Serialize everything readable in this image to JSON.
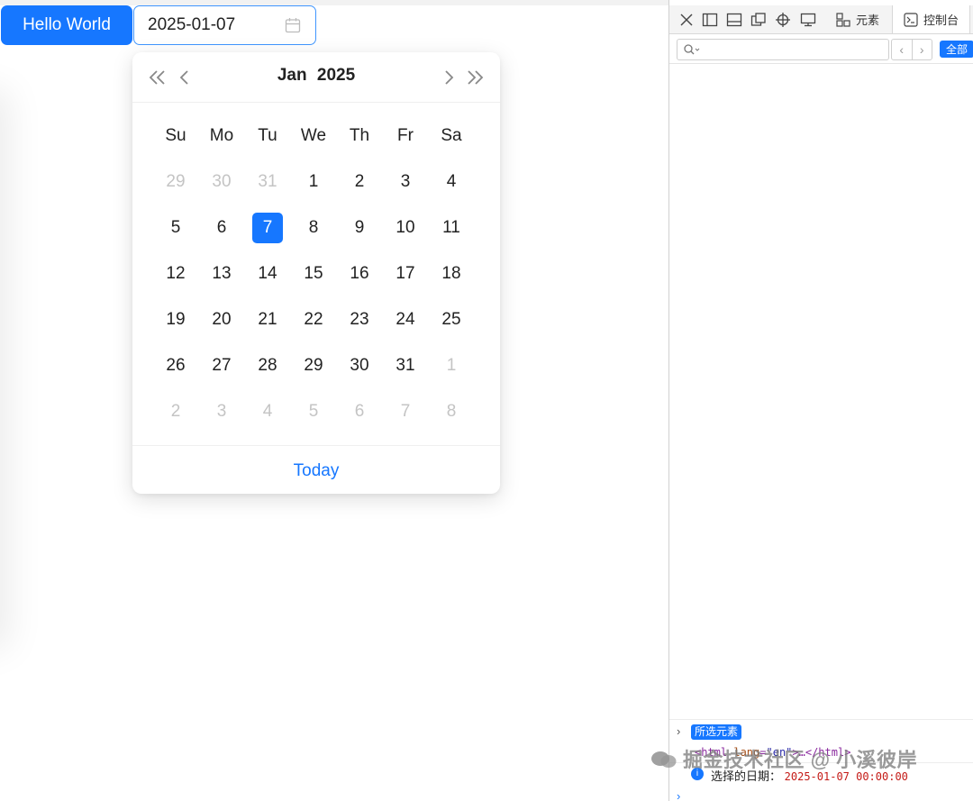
{
  "page": {
    "hello_button": "Hello World",
    "date_value": "2025-01-07",
    "calendar_icon": "calendar-icon"
  },
  "picker": {
    "month": "Jan",
    "year": "2025",
    "nav_icons": [
      "double-chevron-left-icon",
      "chevron-left-icon",
      "chevron-right-icon",
      "double-chevron-right-icon"
    ],
    "weekdays": [
      "Su",
      "Mo",
      "Tu",
      "We",
      "Th",
      "Fr",
      "Sa"
    ],
    "weeks": [
      [
        {
          "d": "29",
          "muted": true
        },
        {
          "d": "30",
          "muted": true
        },
        {
          "d": "31",
          "muted": true
        },
        {
          "d": "1"
        },
        {
          "d": "2"
        },
        {
          "d": "3"
        },
        {
          "d": "4"
        }
      ],
      [
        {
          "d": "5"
        },
        {
          "d": "6"
        },
        {
          "d": "7",
          "selected": true
        },
        {
          "d": "8"
        },
        {
          "d": "9"
        },
        {
          "d": "10"
        },
        {
          "d": "11"
        }
      ],
      [
        {
          "d": "12"
        },
        {
          "d": "13"
        },
        {
          "d": "14"
        },
        {
          "d": "15"
        },
        {
          "d": "16"
        },
        {
          "d": "17"
        },
        {
          "d": "18"
        }
      ],
      [
        {
          "d": "19"
        },
        {
          "d": "20"
        },
        {
          "d": "21"
        },
        {
          "d": "22"
        },
        {
          "d": "23"
        },
        {
          "d": "24"
        },
        {
          "d": "25"
        }
      ],
      [
        {
          "d": "26"
        },
        {
          "d": "27"
        },
        {
          "d": "28"
        },
        {
          "d": "29"
        },
        {
          "d": "30"
        },
        {
          "d": "31"
        },
        {
          "d": "1",
          "muted": true
        }
      ],
      [
        {
          "d": "2",
          "muted": true
        },
        {
          "d": "3",
          "muted": true
        },
        {
          "d": "4",
          "muted": true
        },
        {
          "d": "5",
          "muted": true
        },
        {
          "d": "6",
          "muted": true
        },
        {
          "d": "7",
          "muted": true
        },
        {
          "d": "8",
          "muted": true
        }
      ]
    ],
    "today_label": "Today"
  },
  "devtools": {
    "tabs": [
      {
        "label": "元素",
        "icon": "elements-icon",
        "active": false
      },
      {
        "label": "控制台",
        "icon": "console-icon",
        "active": true
      }
    ],
    "toolbar_icons": [
      "close-icon",
      "dock-left-icon",
      "dock-bottom-icon",
      "undock-icon",
      "inspect-icon",
      "device-icon"
    ],
    "filter_all": "全部",
    "badge": "所选元素",
    "html_tag_open": "<html",
    "html_attr": "lang",
    "html_attr_val": "\"en\"",
    "html_rest": ">…</html>",
    "log_label": "选择的日期：",
    "log_value": "2025-01-07 00:00:00"
  },
  "watermark": "掘金技术社区 @ 小溪彼岸",
  "colors": {
    "primary": "#1677ff",
    "muted_text": "#c4c4c4"
  }
}
